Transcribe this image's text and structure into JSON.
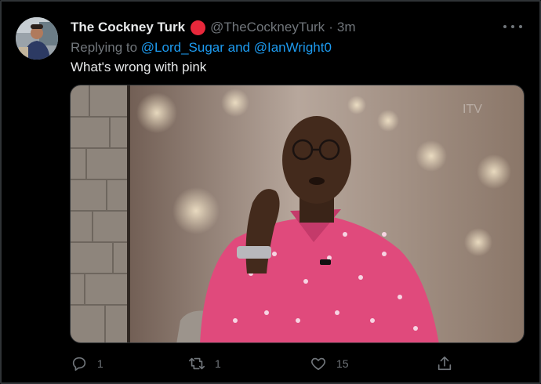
{
  "tweet": {
    "display_name": "The Cockney Turk",
    "handle": "@TheCockneyTurk",
    "separator": "·",
    "time": "3m",
    "replying_prefix": "Replying to",
    "reply_user_1": "@Lord_Sugar",
    "reply_and": "and",
    "reply_user_2": "@IanWright0",
    "text": "What's wrong with pink"
  },
  "actions": {
    "reply": {
      "icon": "reply-icon",
      "count": "1"
    },
    "retweet": {
      "icon": "retweet-icon",
      "count": "1"
    },
    "like": {
      "icon": "heart-icon",
      "count": "15"
    },
    "share": {
      "icon": "share-icon"
    }
  },
  "colors": {
    "background": "#000000",
    "text": "#e7e9ea",
    "muted": "#71767b",
    "link": "#1d9bf0",
    "badge": "#e8283b"
  }
}
